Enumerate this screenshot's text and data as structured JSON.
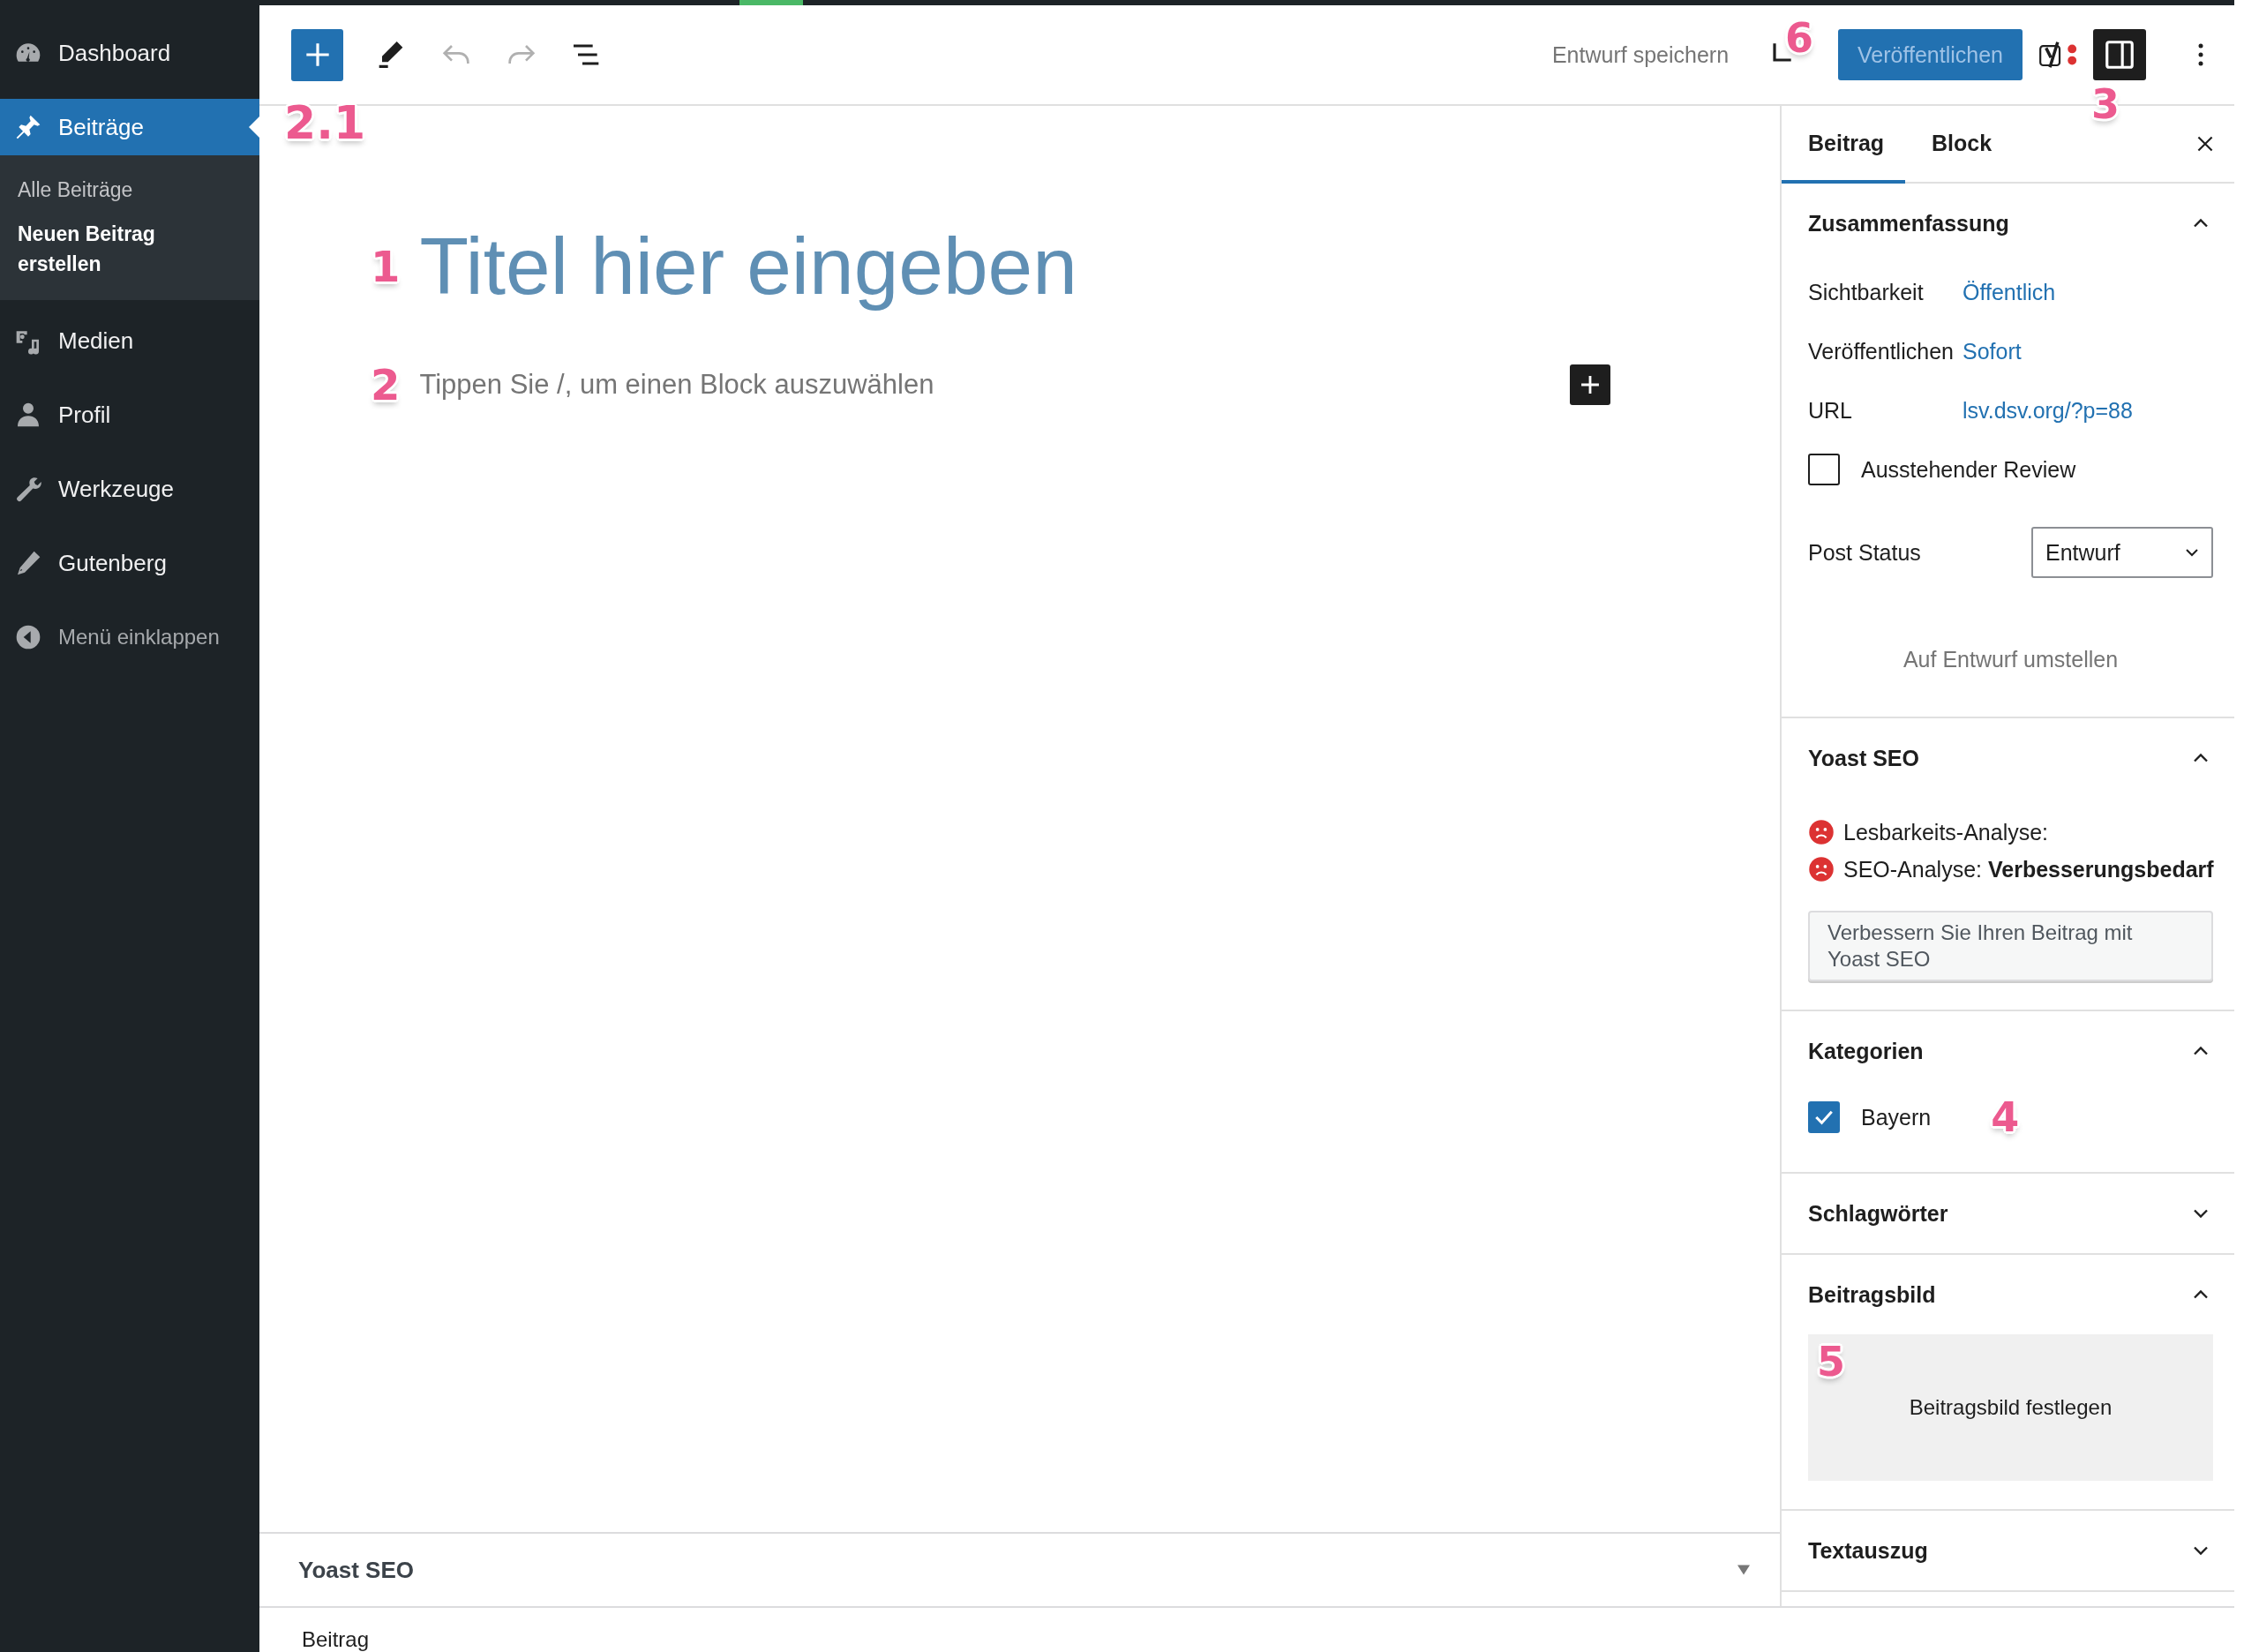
{
  "admin_menu": {
    "items": [
      {
        "label": "Dashboard",
        "selected": false
      },
      {
        "label": "Beiträge",
        "selected": true,
        "submenu": [
          {
            "label": "Alle Beiträge",
            "selected": false
          },
          {
            "label": "Neuen Beitrag erstellen",
            "selected": true
          }
        ]
      },
      {
        "label": "Medien",
        "selected": false
      },
      {
        "label": "Profil",
        "selected": false
      },
      {
        "label": "Werkzeuge",
        "selected": false
      },
      {
        "label": "Gutenberg",
        "selected": false
      }
    ],
    "collapse": {
      "label": "Menü einklappen"
    }
  },
  "toolbar": {
    "inserter_callout": "2.1",
    "save_draft": "Entwurf speichern",
    "preview_callout": "6",
    "publish": {
      "label": "Veröffentlichen",
      "disabled": true
    },
    "settings_callout": "3",
    "settings_open": true
  },
  "editor": {
    "title": {
      "placeholder": "Titel hier eingeben",
      "callout": "1"
    },
    "paragraph": {
      "placeholder": "Tippen Sie /, um einen Block auszuwählen",
      "callout": "2"
    }
  },
  "metabox": {
    "title": "Yoast SEO",
    "expanded": false
  },
  "breadcrumb": "Beitrag",
  "settings_panel": {
    "tabs": [
      {
        "label": "Beitrag",
        "selected": true
      },
      {
        "label": "Block",
        "selected": false
      }
    ],
    "sections": [
      {
        "kind": "summary",
        "title": "Zusammenfassung",
        "expanded": true,
        "rows": [
          {
            "label": "Sichtbarkeit",
            "value": "Öffentlich"
          },
          {
            "label": "Veröffentlichen",
            "value": "Sofort"
          },
          {
            "label": "URL",
            "value": "lsv.dsv.org/?p=88"
          }
        ],
        "review": {
          "label": "Ausstehender Review",
          "checked": false
        },
        "status": {
          "label": "Post Status",
          "value": "Entwurf"
        },
        "switch_button": "Auf Entwurf umstellen"
      },
      {
        "kind": "yoast",
        "title": "Yoast SEO",
        "expanded": true,
        "analyses": [
          {
            "text": "Lesbarkeits-Analyse:",
            "color": "#dc3232"
          },
          {
            "text": "SEO-Analyse: **Verbesserungsbedarf**",
            "color": "#dc3232"
          }
        ],
        "button": "Verbessern Sie Ihren Beitrag mit Yoast SEO"
      },
      {
        "kind": "categories",
        "title": "Kategorien",
        "expanded": true,
        "items": [
          {
            "label": "Bayern",
            "checked": true
          }
        ],
        "callout": "4"
      },
      {
        "title": "Schlagwörter",
        "expanded": false
      },
      {
        "kind": "featured_image",
        "title": "Beitragsbild",
        "expanded": true,
        "button": "Beitragsbild festlegen",
        "callout": "5"
      },
      {
        "title": "Textauszug",
        "expanded": false
      }
    ]
  }
}
